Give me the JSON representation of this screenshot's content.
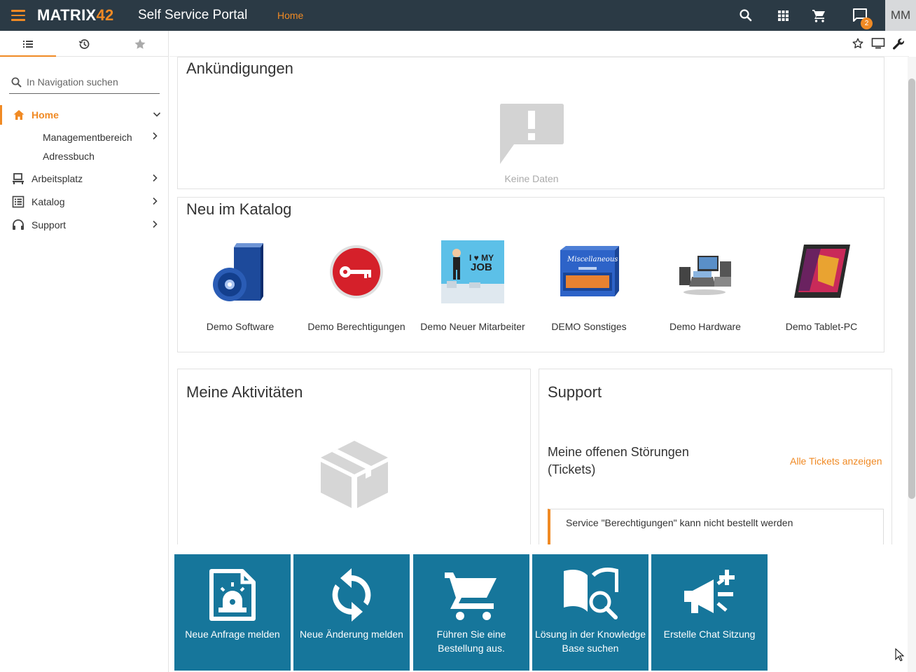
{
  "header": {
    "brand_word": "MATRIX",
    "brand_num": "42",
    "portal_title": "Self Service Portal",
    "breadcrumb": "Home",
    "notification_count": "2",
    "user_initials": "MM"
  },
  "sidebar": {
    "search_placeholder": "In Navigation suchen",
    "items": [
      {
        "label": "Home",
        "icon": "home-icon"
      },
      {
        "label": "Managementbereich"
      },
      {
        "label": "Adressbuch"
      },
      {
        "label": "Arbeitsplatz",
        "icon": "workplace-icon"
      },
      {
        "label": "Katalog",
        "icon": "catalog-icon"
      },
      {
        "label": "Support",
        "icon": "headset-icon"
      }
    ]
  },
  "announcements": {
    "title": "Ankündigungen",
    "empty_text": "Keine Daten"
  },
  "catalog": {
    "title": "Neu im Katalog",
    "items": [
      {
        "label": "Demo Software"
      },
      {
        "label": "Demo Berechtigungen"
      },
      {
        "label": "Demo Neuer Mitarbeiter",
        "badge_line1": "I ♥ MY",
        "badge_line2": "JOB"
      },
      {
        "label": "DEMO Sonstiges",
        "badge": "Miscellaneous"
      },
      {
        "label": "Demo Hardware"
      },
      {
        "label": "Demo Tablet-PC"
      }
    ]
  },
  "activities": {
    "title": "Meine Aktivitäten"
  },
  "support": {
    "title": "Support",
    "subtitle": "Meine offenen Störungen (Tickets)",
    "link": "Alle Tickets anzeigen",
    "ticket_title": "Service \"Berechtigungen\" kann nicht bestellt werden"
  },
  "tiles": [
    {
      "label": "Neue Anfrage melden",
      "icon": "alarm-report-icon"
    },
    {
      "label": "Neue Änderung melden",
      "icon": "sync-icon"
    },
    {
      "label": "Führen Sie eine Bestellung aus.",
      "icon": "cart-icon"
    },
    {
      "label": "Lösung in der Knowledge Base suchen",
      "icon": "book-search-icon"
    },
    {
      "label": "Erstelle Chat Sitzung",
      "icon": "megaphone-plus-icon"
    }
  ],
  "colors": {
    "accent": "#f08a24",
    "topbar": "#2b3a45",
    "tile": "#16769b"
  }
}
